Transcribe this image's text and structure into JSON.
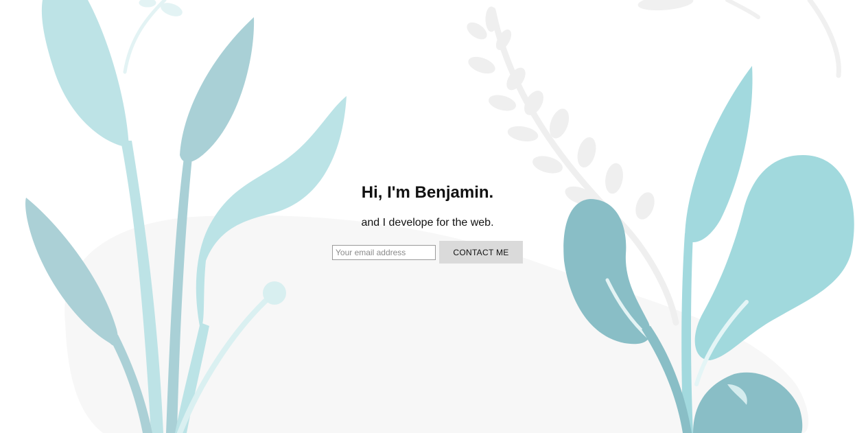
{
  "hero": {
    "title": "Hi, I'm Benjamin.",
    "subtitle": "and I develope for the web."
  },
  "contact_form": {
    "email_placeholder": "Your email address",
    "email_value": "",
    "button_label": "CONTACT ME"
  },
  "colors": {
    "background": "#ffffff",
    "blob": "#f6f6f6",
    "sprig": "#eeeeee",
    "leaf_light": "#bce4e7",
    "leaf_mid": "#a9d2d8",
    "leaf_aqua": "#a0d9de",
    "leaf_dark": "#89bfc6",
    "button_bg": "#dadada"
  }
}
